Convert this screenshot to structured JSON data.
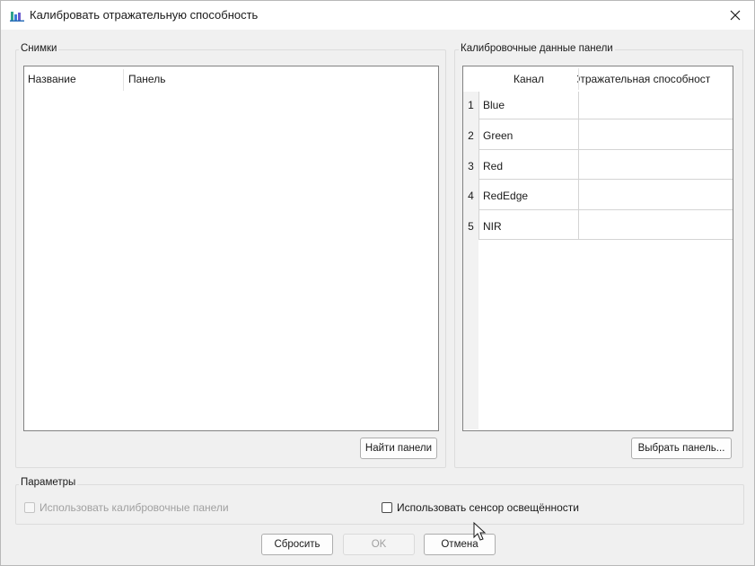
{
  "window": {
    "title": "Калибровать отражательную способность"
  },
  "images_group": {
    "label": "Снимки",
    "columns": [
      "Название",
      "Панель"
    ],
    "find_button": "Найти панели"
  },
  "panel_group": {
    "label": "Калибровочные данные панели",
    "columns": [
      "Канал",
      "Отражательная способност"
    ],
    "rows": [
      {
        "num": "1",
        "channel": "Blue",
        "reflectance": ""
      },
      {
        "num": "2",
        "channel": "Green",
        "reflectance": ""
      },
      {
        "num": "3",
        "channel": "Red",
        "reflectance": ""
      },
      {
        "num": "4",
        "channel": "RedEdge",
        "reflectance": ""
      },
      {
        "num": "5",
        "channel": "NIR",
        "reflectance": ""
      }
    ],
    "select_button": "Выбрать панель..."
  },
  "params_group": {
    "label": "Параметры",
    "use_panels_label": "Использовать калибровочные панели",
    "use_panels_checked": false,
    "use_panels_enabled": false,
    "use_sensor_label": "Использовать сенсор освещённости",
    "use_sensor_checked": false
  },
  "footer": {
    "reset_label": "Сбросить",
    "ok_label": "OK",
    "cancel_label": "Отмена"
  },
  "icons": {
    "app": "reflectance-chart-icon",
    "close": "close-icon",
    "cursor": "mouse-pointer-icon"
  }
}
